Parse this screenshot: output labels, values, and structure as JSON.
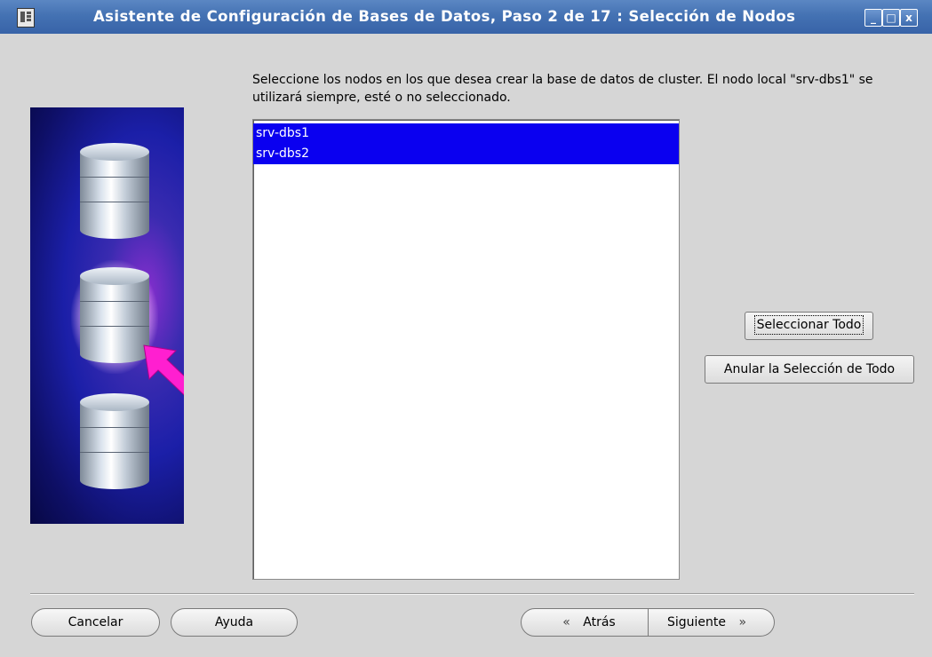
{
  "window": {
    "title": "Asistente de Configuración de Bases de Datos, Paso 2 de 17 : Selección de Nodos",
    "controls": {
      "minimize": "_",
      "maximize": "□",
      "close": "x"
    }
  },
  "main": {
    "instructions": "Seleccione los nodos en los que desea crear la base de datos de cluster. El nodo local \"srv-dbs1\" se utilizará siempre, esté o no seleccionado.",
    "nodes": [
      {
        "name": "srv-dbs1",
        "selected": true
      },
      {
        "name": "srv-dbs2",
        "selected": true
      }
    ],
    "select_all_label": "Seleccionar Todo",
    "deselect_all_label": "Anular la Selección de Todo"
  },
  "footer": {
    "cancel_label": "Cancelar",
    "help_label": "Ayuda",
    "back_label": "Atrás",
    "back_icon": "«",
    "next_label": "Siguiente",
    "next_icon": "»"
  },
  "colors": {
    "titlebar": "#4472b3",
    "selection": "#0a00f0",
    "background": "#d6d6d6"
  }
}
